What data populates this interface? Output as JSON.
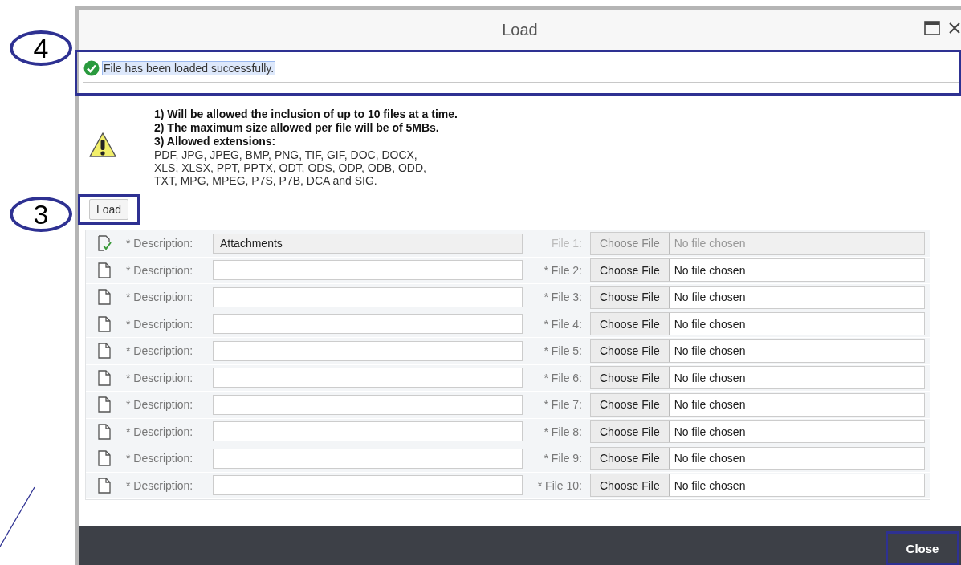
{
  "window": {
    "title": "Load"
  },
  "message": {
    "text": "File has been loaded successfully.",
    "highlighted": true,
    "framed": true
  },
  "notes": {
    "rules": [
      "1) Will be allowed the inclusion of up to 10 files at a time.",
      "2) The maximum size allowed per file will be of 5MBs.",
      "3) Allowed extensions:"
    ],
    "extensions": [
      "PDF, JPG, JPEG, BMP, PNG, TIF, GIF, DOC, DOCX,",
      "XLS, XLSX, PPT, PPTX, ODT, ODS, ODP, ODB, ODD,",
      "TXT, MPG, MPEG, P7S, P7B, DCA and SIG."
    ]
  },
  "load_button": {
    "label": "Load",
    "framed": true
  },
  "rows": [
    {
      "label": "* Description:",
      "value": "Attachments",
      "file_label": "File 1:",
      "button": "Choose File",
      "status": "No file chosen",
      "loaded": true,
      "disabled": true
    },
    {
      "label": "* Description:",
      "file_label": "* File 2:",
      "button": "Choose File",
      "status": "No file chosen",
      "loaded": false,
      "disabled": false
    },
    {
      "label": "* Description:",
      "file_label": "* File 3:",
      "button": "Choose File",
      "status": "No file chosen",
      "loaded": false,
      "disabled": false
    },
    {
      "label": "* Description:",
      "file_label": "* File 4:",
      "button": "Choose File",
      "status": "No file chosen",
      "loaded": false,
      "disabled": false
    },
    {
      "label": "* Description:",
      "file_label": "* File 5:",
      "button": "Choose File",
      "status": "No file chosen",
      "loaded": false,
      "disabled": false
    },
    {
      "label": "* Description:",
      "file_label": "* File 6:",
      "button": "Choose File",
      "status": "No file chosen",
      "loaded": false,
      "disabled": false
    },
    {
      "label": "* Description:",
      "file_label": "* File 7:",
      "button": "Choose File",
      "status": "No file chosen",
      "loaded": false,
      "disabled": false
    },
    {
      "label": "* Description:",
      "file_label": "* File 8:",
      "button": "Choose File",
      "status": "No file chosen",
      "loaded": false,
      "disabled": false
    },
    {
      "label": "* Description:",
      "file_label": "* File 9:",
      "button": "Choose File",
      "status": "No file chosen",
      "loaded": false,
      "disabled": false
    },
    {
      "label": "* Description:",
      "file_label": "* File 10:",
      "button": "Choose File",
      "status": "No file chosen",
      "loaded": false,
      "disabled": false
    }
  ],
  "footer": {
    "close_button": {
      "label": "Close",
      "framed": true
    }
  },
  "callouts": [
    {
      "label": "4",
      "kind": "message"
    },
    {
      "label": "3",
      "kind": "load"
    }
  ]
}
